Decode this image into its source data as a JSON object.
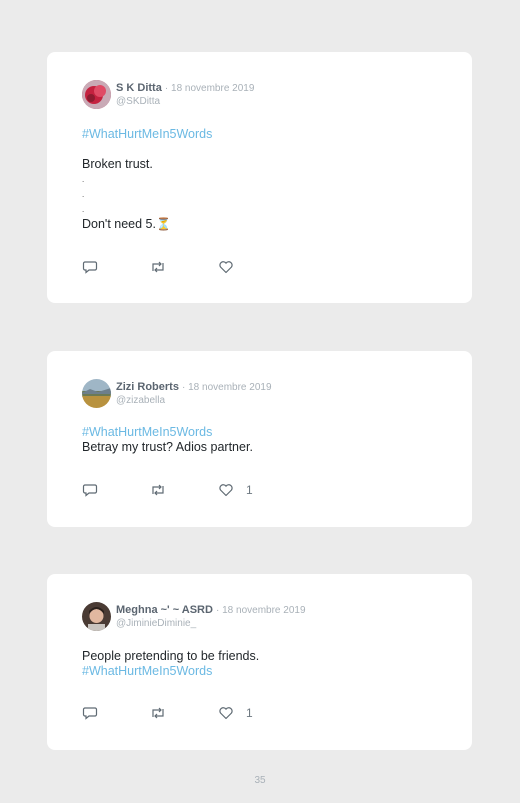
{
  "tweets": [
    {
      "name": "S K Ditta",
      "date": "· 18 novembre 2019",
      "handle": "@SKDitta",
      "hashtag": "#WhatHurtMeIn5Words",
      "lines": [
        "Broken trust.",
        ".",
        ".",
        "."
      ],
      "last_line": "Don't need 5.",
      "emoji": "⏳"
    },
    {
      "name": "Zizi Roberts",
      "date": "· 18 novembre 2019",
      "handle": "@zizabella",
      "hashtag": "#WhatHurtMeIn5Words",
      "text": "Betray my trust? Adios partner.",
      "likes": "1"
    },
    {
      "name": "Meghna ~' ~ ASRD",
      "date": "· 18 novembre 2019",
      "handle": "@JiminieDiminie_",
      "text": "People pretending to be friends.",
      "hashtag": "#WhatHurtMeIn5Words",
      "likes": "1"
    }
  ],
  "page_number": "35",
  "icons": {
    "reply": "reply-icon",
    "retweet": "retweet-icon",
    "like": "heart-icon"
  },
  "colors": {
    "hashtag": "#6bb9e3",
    "name": "#5b6570",
    "meta": "#a9b1b8",
    "background": "#ebebeb"
  }
}
